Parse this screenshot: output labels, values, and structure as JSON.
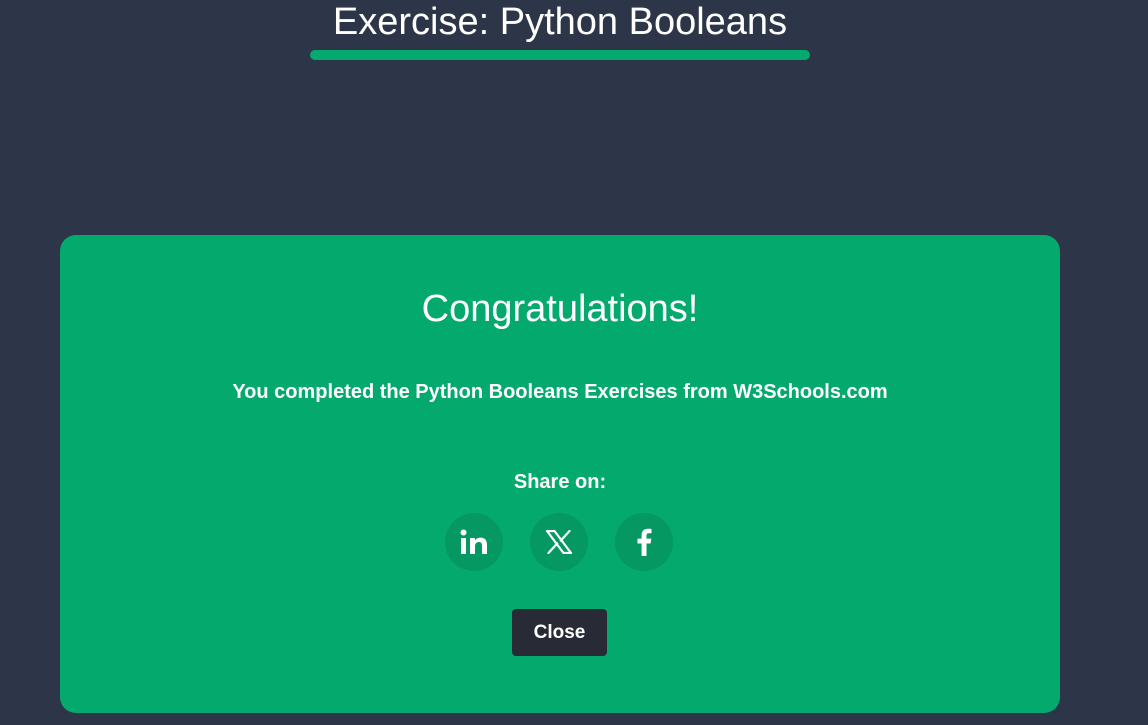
{
  "header": {
    "title": "Exercise: Python Booleans"
  },
  "modal": {
    "heading": "Congratulations!",
    "message": "You completed the Python Booleans Exercises from W3Schools.com",
    "share_label": "Share on:",
    "share_buttons": [
      {
        "network": "linkedin",
        "icon": "linkedin-icon"
      },
      {
        "network": "x",
        "icon": "x-icon"
      },
      {
        "network": "facebook",
        "icon": "facebook-icon"
      }
    ],
    "close_label": "Close"
  },
  "colors": {
    "background": "#2d3648",
    "accent": "#04aa6d",
    "share_button_bg": "#059862",
    "close_button_bg": "#282a35",
    "text": "#ffffff"
  }
}
